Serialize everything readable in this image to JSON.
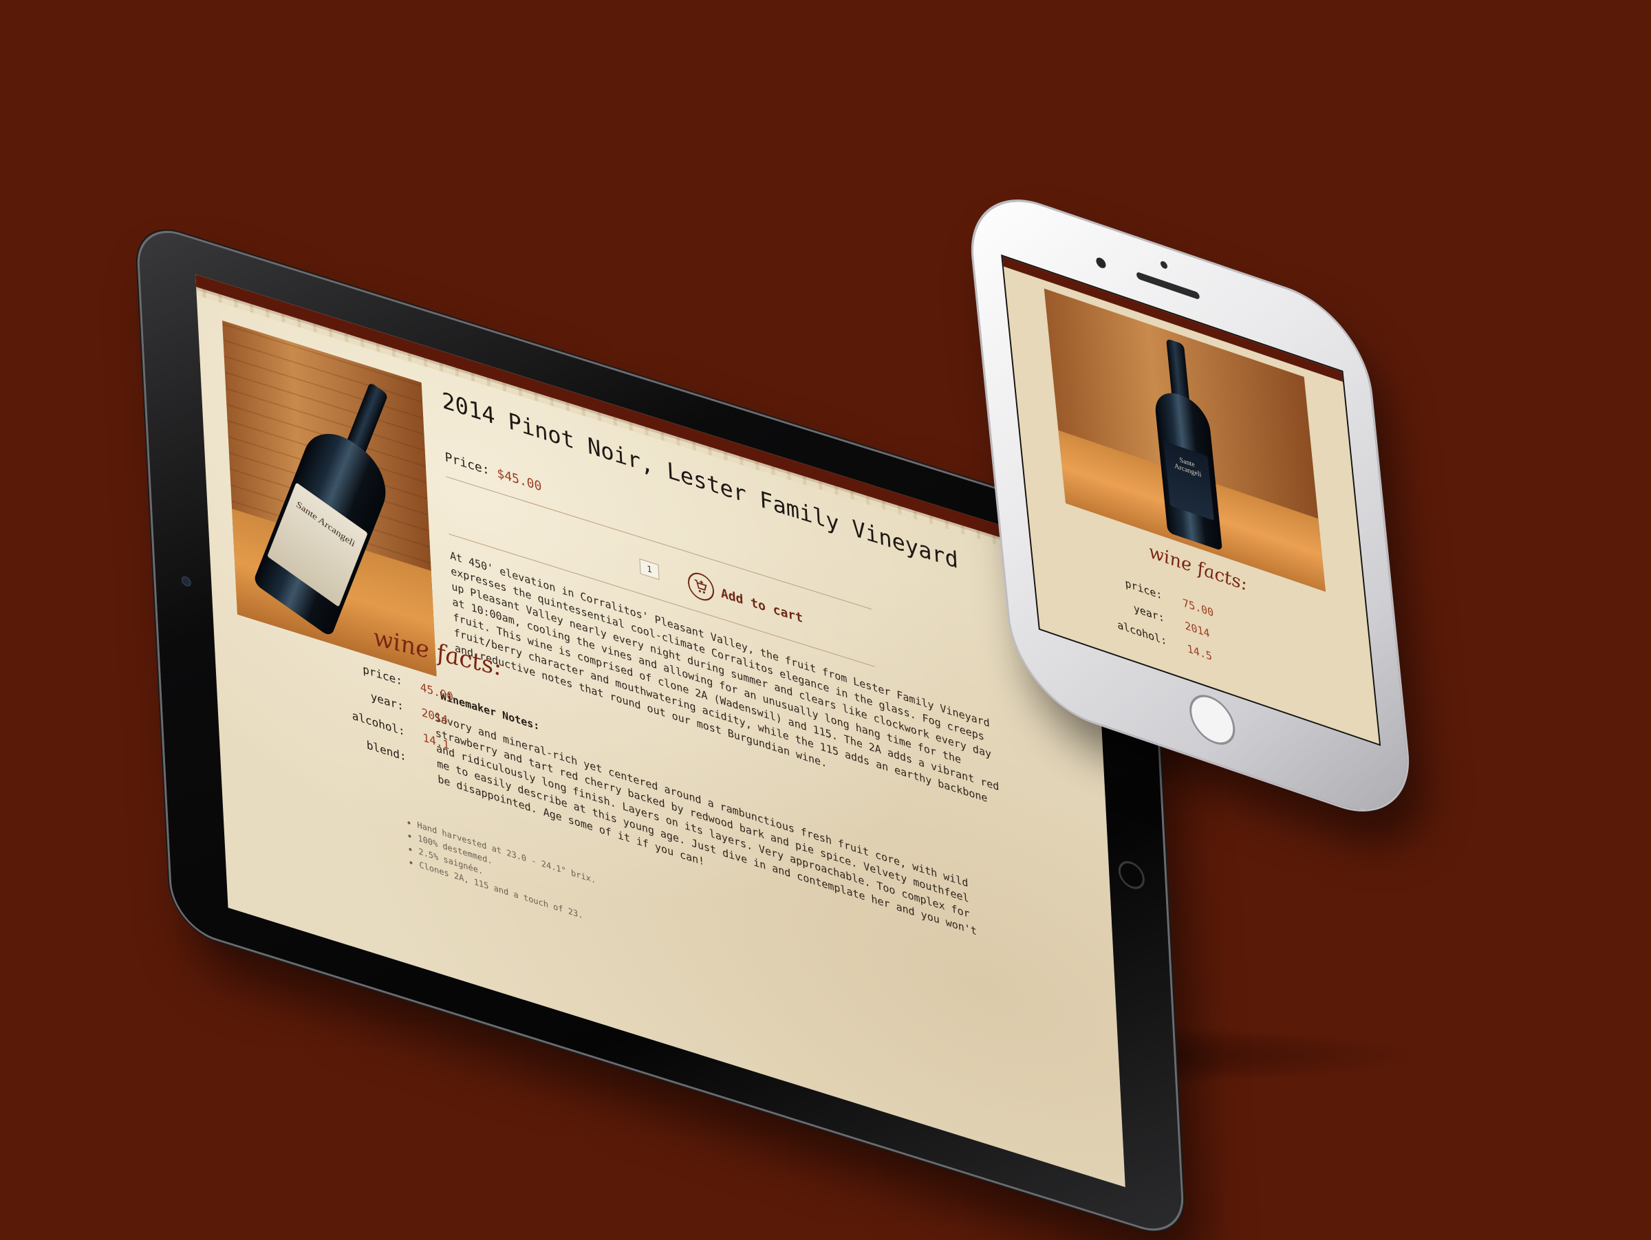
{
  "product": {
    "title": "2014 Pinot Noir, Lester Family Vineyard",
    "price_label": "Price:",
    "price_value": "$45.00",
    "quantity": "1",
    "add_to_cart": "Add to cart",
    "bottle_label_text": "Sante Arcangeli",
    "description": "At 450' elevation in Corralitos' Pleasant Valley, the fruit from Lester Family Vineyard expresses the quintessential cool-climate Corralitos elegance in the glass. Fog creeps up Pleasant Valley nearly every night during summer and clears like clockwork every day at 10:00am, cooling the vines and allowing for an unusually long hang time for the fruit. This wine is comprised of clone 2A (Wadenswil) and 115. The 2A adds a vibrant red fruit/berry character and mouthwatering acidity, while the 115 adds an earthy backbone and reductive notes that round out our most Burgundian wine.",
    "notes_heading": "Winemaker Notes:",
    "notes_text": "Savory and mineral-rich yet centered around a rambunctious fresh fruit core, with wild strawberry and tart red cherry backed by redwood bark and pie spice. Velvety mouthfeel and ridiculously long finish. Layers on its layers. Very approachable. Too complex for me to easily describe at this young age. Just dive in and contemplate her and you won't be disappointed. Age some of it if you can!",
    "bullets": [
      "Hand harvested at 23.0 - 24.1° brix.",
      "100% destemmed.",
      "2.5% saignée.",
      "Clones 2A, 115 and a touch of 23."
    ]
  },
  "tablet_facts": {
    "title": "wine facts:",
    "rows": [
      {
        "label": "price:",
        "value": "45.00"
      },
      {
        "label": "year:",
        "value": "2014"
      },
      {
        "label": "alcohol:",
        "value": "14.1"
      },
      {
        "label": "blend:",
        "value": ""
      }
    ]
  },
  "phone_facts": {
    "title": "wine facts:",
    "bottle_label_text": "Sante Arcangeli",
    "rows": [
      {
        "label": "price:",
        "value": "75.00"
      },
      {
        "label": "year:",
        "value": "2014"
      },
      {
        "label": "alcohol:",
        "value": "14.5"
      }
    ]
  },
  "colors": {
    "background": "#5a1a08",
    "accent": "#9a3b22",
    "paper": "#e8dcc0"
  },
  "icons": [
    "cart-plus-icon",
    "home-button-icon",
    "camera-icon"
  ]
}
